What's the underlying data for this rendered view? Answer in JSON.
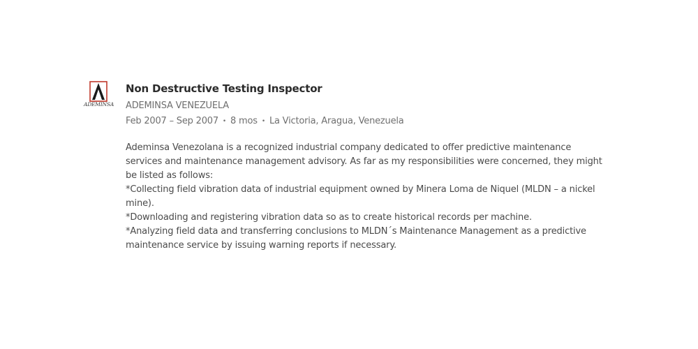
{
  "position": {
    "title": "Non Destructive Testing Inspector",
    "company": "ADEMINSA VENEZUELA",
    "dates": "Feb 2007 – Sep 2007",
    "separator": "•",
    "duration": "8 mos",
    "location": "La Victoria, Aragua, Venezuela",
    "logo": {
      "icon": "ademinsa-logo-icon",
      "text": "ADEMINSA",
      "accent_color": "#c0392b",
      "dark_color": "#1a1a1a"
    },
    "description": [
      "Ademinsa Venezolana is a recognized industrial company dedicated to offer predictive maintenance services and maintenance management advisory. As far as my responsibilities were concerned, they might be listed as follows:",
      "*Collecting field vibration data of industrial equipment owned by Minera Loma de Niquel (MLDN – a nickel mine).",
      "*Downloading and registering vibration data so as to create historical records per machine.",
      "*Analyzing field data and transferring conclusions to MLDN´s Maintenance Management as a predictive maintenance service by issuing warning reports if necessary."
    ]
  }
}
